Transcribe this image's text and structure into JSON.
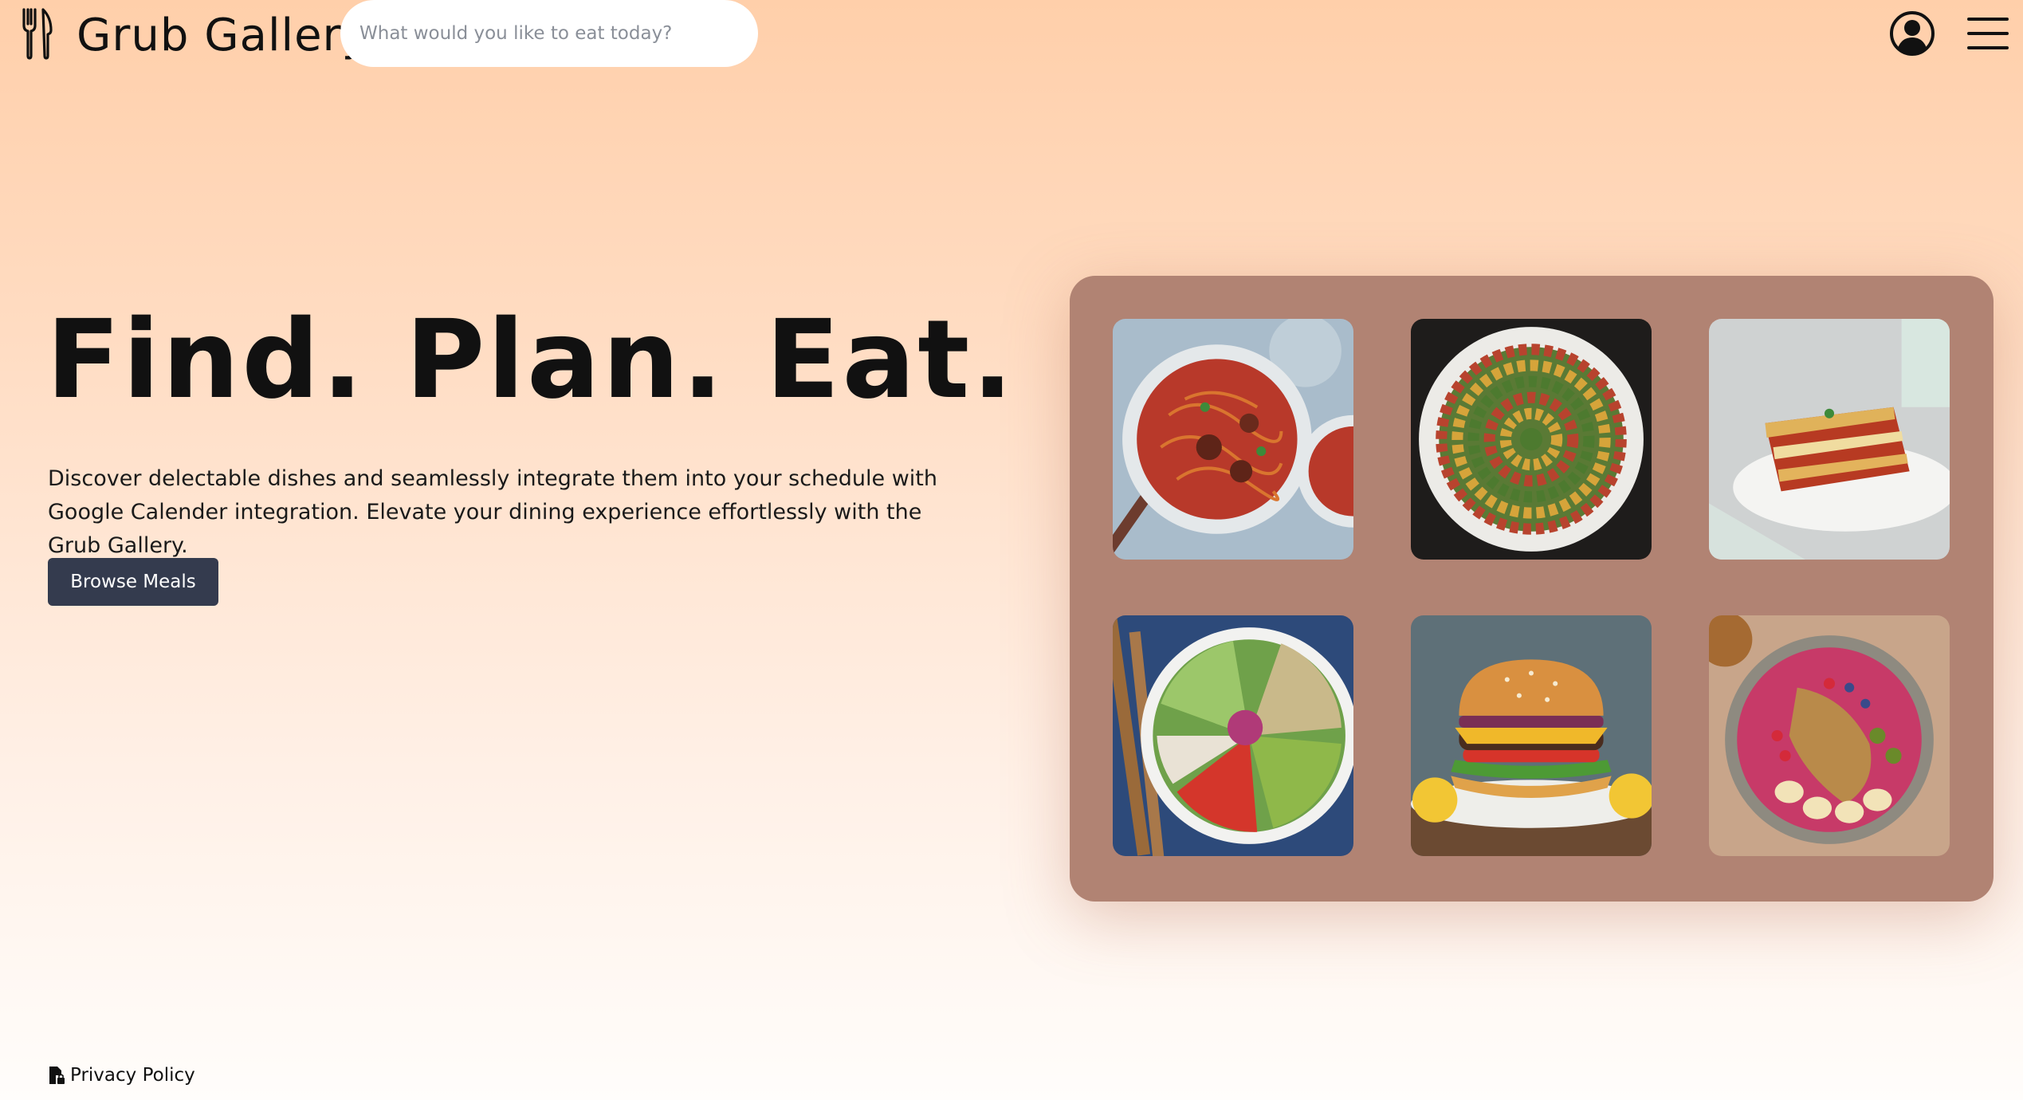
{
  "header": {
    "brand": "Grub Gallery",
    "search_placeholder": "What would you like to eat today?",
    "icons": [
      "fork-knife-icon",
      "profile-icon",
      "hamburger-menu-icon"
    ]
  },
  "hero": {
    "headline": "Find. Plan. Eat.",
    "description": "Discover delectable dishes and seamlessly integrate them into your schedule with Google Calender integration. Elevate your dining experience effortlessly with the Grub Gallery.",
    "cta_label": "Browse Meals"
  },
  "gallery": {
    "items": [
      {
        "name": "spaghetti-meatballs"
      },
      {
        "name": "ratatouille"
      },
      {
        "name": "lasagna"
      },
      {
        "name": "chicken-salad-bowl"
      },
      {
        "name": "cheeseburger"
      },
      {
        "name": "smoothie-bowl"
      }
    ]
  },
  "footer": {
    "privacy_label": "Privacy Policy"
  },
  "colors": {
    "cta_bg": "#343b4e",
    "gallery_bg": "#b18373",
    "page_top": "#ffcfaa",
    "page_bottom": "#fffdfb"
  }
}
